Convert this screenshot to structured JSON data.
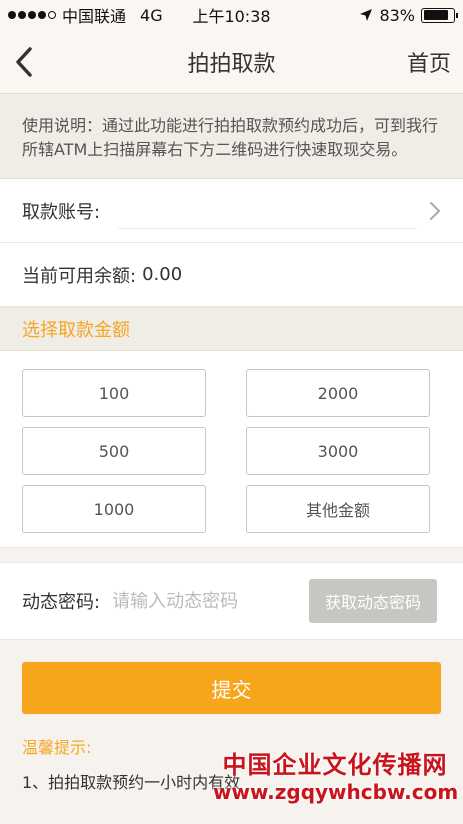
{
  "status_bar": {
    "carrier": "中国联通",
    "network": "4G",
    "time": "上午10:38",
    "battery": "83%",
    "battery_level": 0.83,
    "signal_strength": 4
  },
  "nav": {
    "title": "拍拍取款",
    "home_label": "首页",
    "back_icon": "chevron-left-icon"
  },
  "instructions": "使用说明：通过此功能进行拍拍取款预约成功后，可到我行所辖ATM上扫描屏幕右下方二维码进行快速取现交易。",
  "account": {
    "label": "取款账号:",
    "value": ""
  },
  "balance": {
    "label": "当前可用余额:",
    "value": "0.00"
  },
  "amount_section": {
    "title": "选择取款金额",
    "options": [
      "100",
      "2000",
      "500",
      "3000",
      "1000",
      "其他金额"
    ]
  },
  "otp": {
    "label": "动态密码:",
    "placeholder": "请输入动态密码",
    "button_label": "获取动态密码"
  },
  "submit_label": "提交",
  "tips": {
    "title": "温馨提示:",
    "item_1": "1、拍拍取款预约一小时内有效"
  },
  "watermark": {
    "name": "中国企业文化传播网",
    "url": "www.zgqywhcbw.com"
  },
  "colors": {
    "accent": "#f7a61c",
    "section_title": "#f5a623",
    "disabled_button": "#c8c6c3",
    "watermark": "#c8151d"
  }
}
